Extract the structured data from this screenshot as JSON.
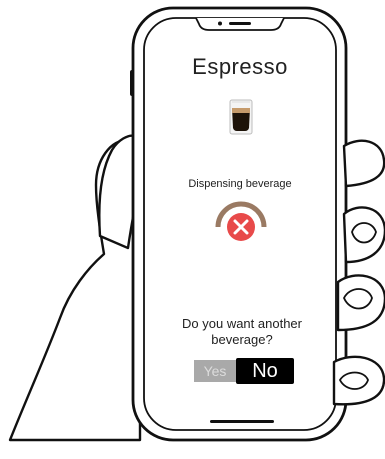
{
  "screen": {
    "title": "Espresso",
    "beverage_icon": "espresso-cup-icon",
    "status_text": "Dispensing beverage",
    "status_icon": "error-x-icon",
    "question": "Do you want another beverage?",
    "buttons": {
      "yes_label": "Yes",
      "no_label": "No"
    }
  },
  "colors": {
    "error": "#e84a4a",
    "gauge": "#9a7a63",
    "selected_button": "#000000",
    "unselected_button": "#a9a9a9"
  }
}
